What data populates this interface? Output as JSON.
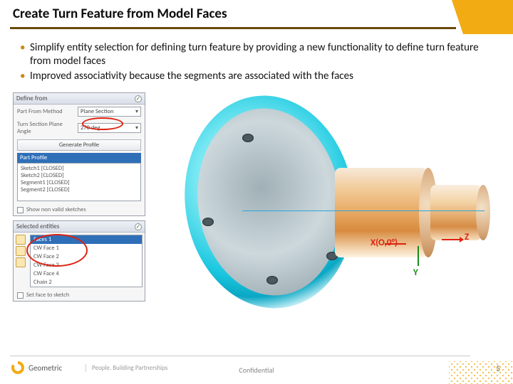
{
  "header": {
    "title": "Create Turn Feature from Model Faces"
  },
  "bullets": [
    "Simplify entity selection for defining turn feature by providing a new functionality to define turn feature from model faces",
    "Improved associativity because the segments are associated with the faces"
  ],
  "panel1": {
    "title": "Define from",
    "row1_label": "Part From Method",
    "row1_value": "Plane Section",
    "row2_label": "Turn Section Plane Angle",
    "row2_value": "270 deg",
    "generate": "Generate Profile",
    "strip": "Part Profile",
    "items": [
      "Sketch1 [CLOSED]",
      "Sketch2 [CLOSED]",
      "Segment1 [CLOSED]",
      "Segment2 [CLOSED]"
    ],
    "checkbox": "Show non valid sketches"
  },
  "panel2": {
    "title": "Selected entities",
    "strip": "Faces 1",
    "items": [
      "CW Face 1",
      "CW Face 2",
      "CW Face 3",
      "CW Face 4",
      "Chain 2"
    ],
    "checkbox": "Set face to sketch"
  },
  "axes": {
    "x": "X(O,0°)",
    "y": "Y",
    "z": "Z"
  },
  "footer": {
    "brand": "Geometric",
    "tagline": "People. Building Partnerships",
    "confidential": "Confidential",
    "page": "5"
  }
}
